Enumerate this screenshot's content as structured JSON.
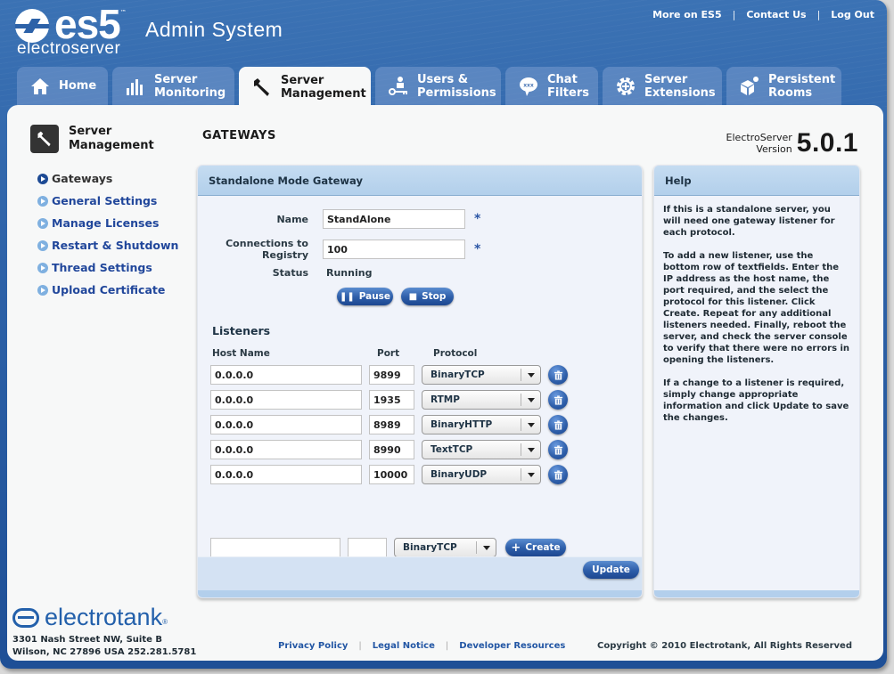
{
  "header": {
    "logo_text": "es5",
    "logo_tm": "™",
    "logo_sub": "electroserver",
    "app_title": "Admin System",
    "top_links": [
      "More on ES5",
      "Contact Us",
      "Log Out"
    ]
  },
  "tabs": [
    {
      "label_line1": "Home",
      "label_line2": "",
      "icon": "home-icon",
      "active": false
    },
    {
      "label_line1": "Server",
      "label_line2": "Monitoring",
      "icon": "bar-chart-icon",
      "active": false
    },
    {
      "label_line1": "Server",
      "label_line2": "Management",
      "icon": "wrench-icon",
      "active": true
    },
    {
      "label_line1": "Users &",
      "label_line2": "Permissions",
      "icon": "user-key-icon",
      "active": false
    },
    {
      "label_line1": "Chat",
      "label_line2": "Filters",
      "icon": "chat-bubble-icon",
      "active": false
    },
    {
      "label_line1": "Server",
      "label_line2": "Extensions",
      "icon": "gear-plus-icon",
      "active": false
    },
    {
      "label_line1": "Persistent",
      "label_line2": "Rooms",
      "icon": "cube-icon",
      "active": false
    }
  ],
  "sidebar": {
    "title_line1": "Server",
    "title_line2": "Management",
    "items": [
      {
        "label": "Gateways",
        "active": true
      },
      {
        "label": "General Settings",
        "active": false
      },
      {
        "label": "Manage Licenses",
        "active": false
      },
      {
        "label": "Restart & Shutdown",
        "active": false
      },
      {
        "label": "Thread Settings",
        "active": false
      },
      {
        "label": "Upload Certificate",
        "active": false
      }
    ]
  },
  "page": {
    "title": "GATEWAYS",
    "version_label_line1": "ElectroServer",
    "version_label_line2": "Version",
    "version_number": "5.0.1"
  },
  "gateway": {
    "panel_title": "Standalone Mode Gateway",
    "name_label": "Name",
    "name_value": "StandAlone",
    "connections_label": "Connections to Registry",
    "connections_value": "100",
    "required_marker": "*",
    "status_label": "Status",
    "status_value": "Running",
    "pause_label": "Pause",
    "stop_label": "Stop",
    "listeners_title": "Listeners",
    "columns": {
      "host": "Host Name",
      "port": "Port",
      "protocol": "Protocol"
    },
    "listeners": [
      {
        "host": "0.0.0.0",
        "port": "9899",
        "protocol": "BinaryTCP"
      },
      {
        "host": "0.0.0.0",
        "port": "1935",
        "protocol": "RTMP"
      },
      {
        "host": "0.0.0.0",
        "port": "8989",
        "protocol": "BinaryHTTP"
      },
      {
        "host": "0.0.0.0",
        "port": "8990",
        "protocol": "TextTCP"
      },
      {
        "host": "0.0.0.0",
        "port": "10000",
        "protocol": "BinaryUDP"
      }
    ],
    "new_listener": {
      "host": "",
      "port": "",
      "protocol": "BinaryTCP"
    },
    "create_label": "Create",
    "update_label": "Update"
  },
  "help": {
    "title": "Help",
    "paragraphs": [
      "If this is a standalone server, you will need one gateway listener for each protocol.",
      "To add a new listener, use the bottom row of textfields. Enter the IP address as the host name, the port required, and the select the protocol for this listener. Click Create. Repeat for any additional listeners needed. Finally, reboot the server, and check the server console to verify that there were no errors in opening the listeners.",
      "If a change to a listener is required, simply change appropriate information and click Update to save the changes."
    ]
  },
  "footer": {
    "brand": "electrotank",
    "brand_reg": "®",
    "address_line1": "3301 Nash Street NW, Suite B",
    "address_line2": "Wilson, NC 27896 USA 252.281.5781",
    "links": [
      "Privacy Policy",
      "Legal Notice",
      "Developer Resources"
    ],
    "copyright": "Copyright © 2010 Electrotank, All Rights Reserved"
  },
  "colors": {
    "brand_blue": "#2d62a8",
    "link_blue": "#21479b",
    "panel_header": "#b2cfeb",
    "panel_bg": "#f0f3fa"
  }
}
